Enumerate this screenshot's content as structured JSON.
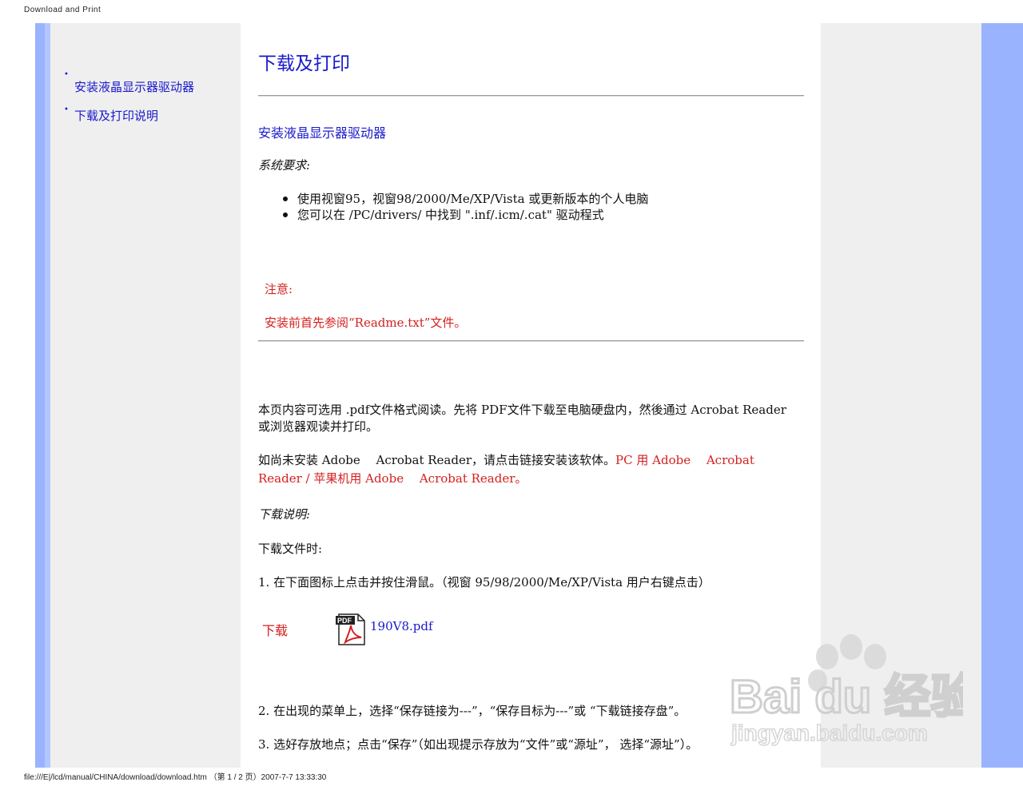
{
  "print_header": "Download and Print",
  "print_footer": "file:///E|/lcd/manual/CHINA/download/download.htm （第 1 / 2 页）2007-7-7 13:33:30",
  "sidebar": {
    "items": [
      {
        "label": "安装液晶显示器驱动器"
      },
      {
        "label": "下载及打印说明"
      }
    ]
  },
  "main": {
    "title": "下载及打印",
    "section_heading": "安装液晶显示器驱动器",
    "system_req_label": "系统要求:",
    "requirements": [
      "使用视窗95，视窗98/2000/Me/XP/Vista 或更新版本的个人电脑",
      "您可以在 /PC/drivers/ 中找到 \".inf/.icm/.cat\" 驱动程式"
    ],
    "note_label": "注意:",
    "note_text": "安装前首先参阅“Readme.txt”文件。",
    "pdf_intro": "本页内容可选用 .pdf文件格式阅读。先将 PDF文件下载至电脑硬盘内，然後通过 Acrobat Reader或浏览器观读并打印。",
    "install_prefix": "如尚未安装 Adobe　 Acrobat Reader，请点击链接安装该软体。",
    "link_pc": "PC 用 Adobe　 Acrobat Reader",
    "link_sep": " / ",
    "link_mac": "苹果机用 Adobe　 Acrobat Reader",
    "link_end": "。",
    "download_instr_label": "下载说明:",
    "download_when": "下载文件时:",
    "step1": "1. 在下面图标上点击并按住滑鼠。（视窗 95/98/2000/Me/XP/Vista 用户右键点击）",
    "download_label": "下载",
    "pdf_file": "190V8.pdf",
    "step2": "2. 在出现的菜单上，选择“保存链接为---”，“保存目标为---”或 “下载链接存盘”。",
    "step3": "3. 选好存放地点；点击“保存”（如出现提示存放为“文件”或“源址”， 选择“源址”）。"
  },
  "watermark": {
    "brand_top": "Bai du 经验",
    "brand_bottom": "jingyan.baidu.com"
  },
  "colors": {
    "link_blue": "#1a1acc",
    "note_red": "#d42020",
    "side_blue": "#99b3ff",
    "panel_gray": "#efefef"
  }
}
